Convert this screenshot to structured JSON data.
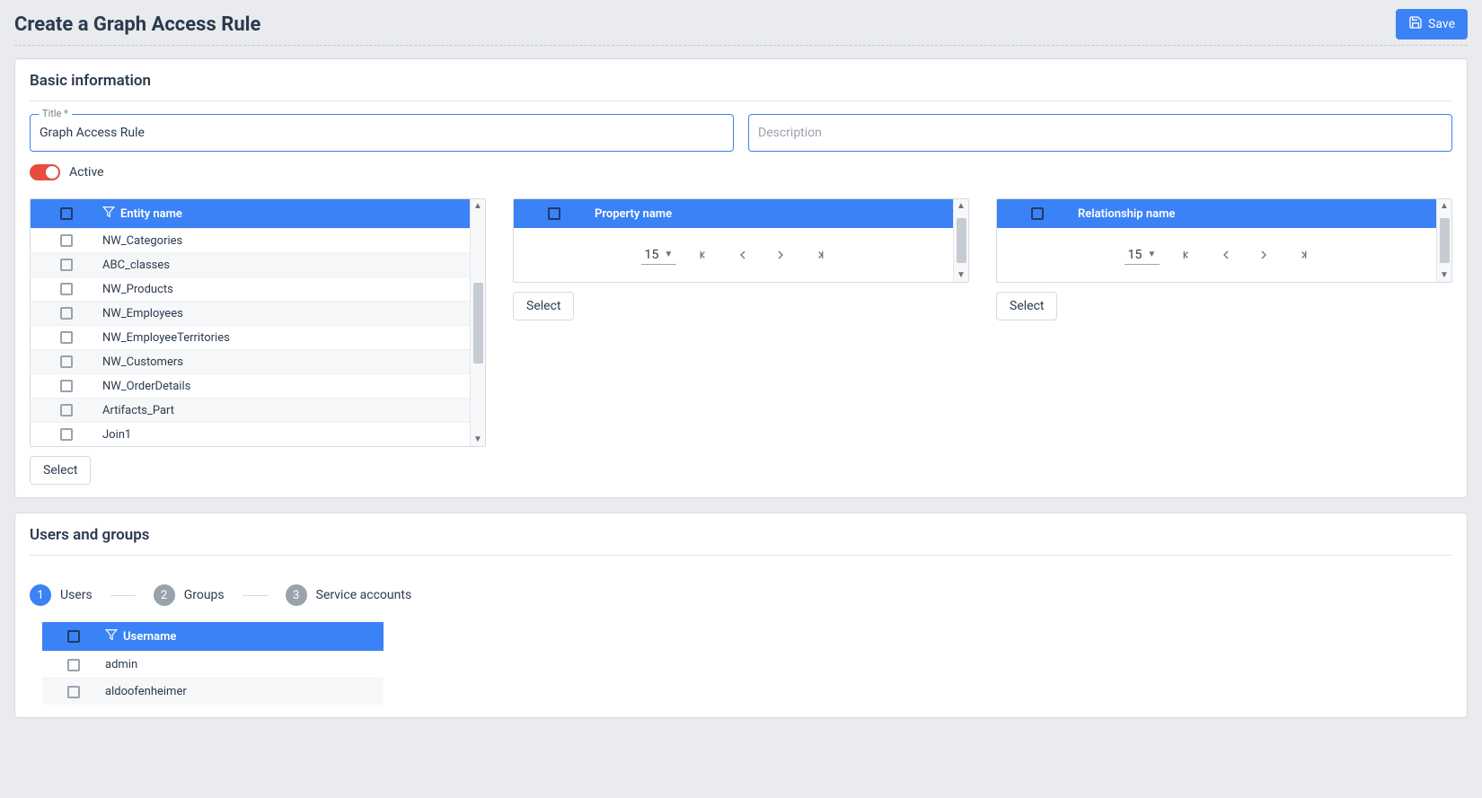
{
  "header": {
    "title": "Create a Graph Access Rule",
    "save_label": "Save"
  },
  "basic_info": {
    "panel_title": "Basic information",
    "title_label": "Title *",
    "title_value": "Graph Access Rule",
    "description_placeholder": "Description",
    "active_label": "Active",
    "entity_table": {
      "header": "Entity name",
      "rows": [
        "NW_Categories",
        "ABC_classes",
        "NW_Products",
        "NW_Employees",
        "NW_EmployeeTerritories",
        "NW_Customers",
        "NW_OrderDetails",
        "Artifacts_Part",
        "Join1"
      ],
      "select_label": "Select"
    },
    "property_table": {
      "header": "Property name",
      "page_size": "15",
      "select_label": "Select"
    },
    "relationship_table": {
      "header": "Relationship name",
      "page_size": "15",
      "select_label": "Select"
    }
  },
  "users_groups": {
    "panel_title": "Users and groups",
    "steps": [
      {
        "num": "1",
        "label": "Users"
      },
      {
        "num": "2",
        "label": "Groups"
      },
      {
        "num": "3",
        "label": "Service accounts"
      }
    ],
    "users_table": {
      "header": "Username",
      "rows": [
        "admin",
        "aldoofenheimer"
      ]
    }
  }
}
